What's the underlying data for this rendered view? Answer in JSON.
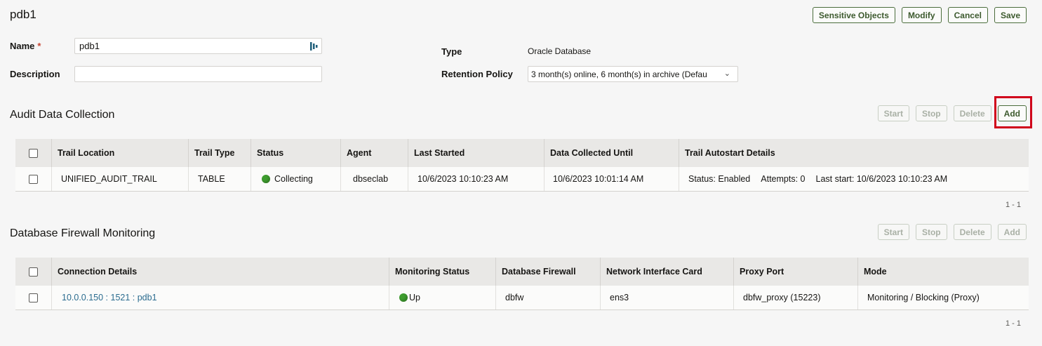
{
  "page": {
    "title": "pdb1"
  },
  "top_actions": [
    "Sensitive Objects",
    "Modify",
    "Cancel",
    "Save"
  ],
  "form": {
    "name_label": "Name",
    "required_mark": "*",
    "name_value": "pdb1",
    "description_label": "Description",
    "description_value": "",
    "type_label": "Type",
    "type_value": "Oracle Database",
    "retention_label": "Retention Policy",
    "retention_value": "3 month(s) online, 6 month(s) in archive (Defau"
  },
  "audit": {
    "title": "Audit Data Collection",
    "actions": [
      "Start",
      "Stop",
      "Delete",
      "Add"
    ],
    "columns": [
      "Trail Location",
      "Trail Type",
      "Status",
      "Agent",
      "Last Started",
      "Data Collected Until",
      "Trail Autostart Details"
    ],
    "row": {
      "trail_location": "UNIFIED_AUDIT_TRAIL",
      "trail_type": "TABLE",
      "status": "Collecting",
      "agent": "dbseclab",
      "last_started": "10/6/2023 10:10:23 AM",
      "data_collected_until": "10/6/2023 10:01:14 AM",
      "autostart_status": "Status: Enabled",
      "autostart_attempts": "Attempts: 0",
      "autostart_last": "Last start: 10/6/2023 10:10:23 AM"
    },
    "pager": "1 - 1"
  },
  "firewall": {
    "title": "Database Firewall Monitoring",
    "actions": [
      "Start",
      "Stop",
      "Delete",
      "Add"
    ],
    "columns": [
      "Connection Details",
      "Monitoring Status",
      "Database Firewall",
      "Network Interface Card",
      "Proxy Port",
      "Mode"
    ],
    "row": {
      "connection": "10.0.0.150 : 1521 : pdb1",
      "monitoring_status": "Up",
      "database_firewall": "dbfw",
      "nic": "ens3",
      "proxy_port": "dbfw_proxy (15223)",
      "mode": "Monitoring / Blocking (Proxy)"
    },
    "pager": "1 - 1"
  },
  "colors": {
    "accent": "#3d5a2e",
    "status_green": "#3e9d2e",
    "highlight": "#d0021b",
    "link": "#2b6c8f"
  }
}
